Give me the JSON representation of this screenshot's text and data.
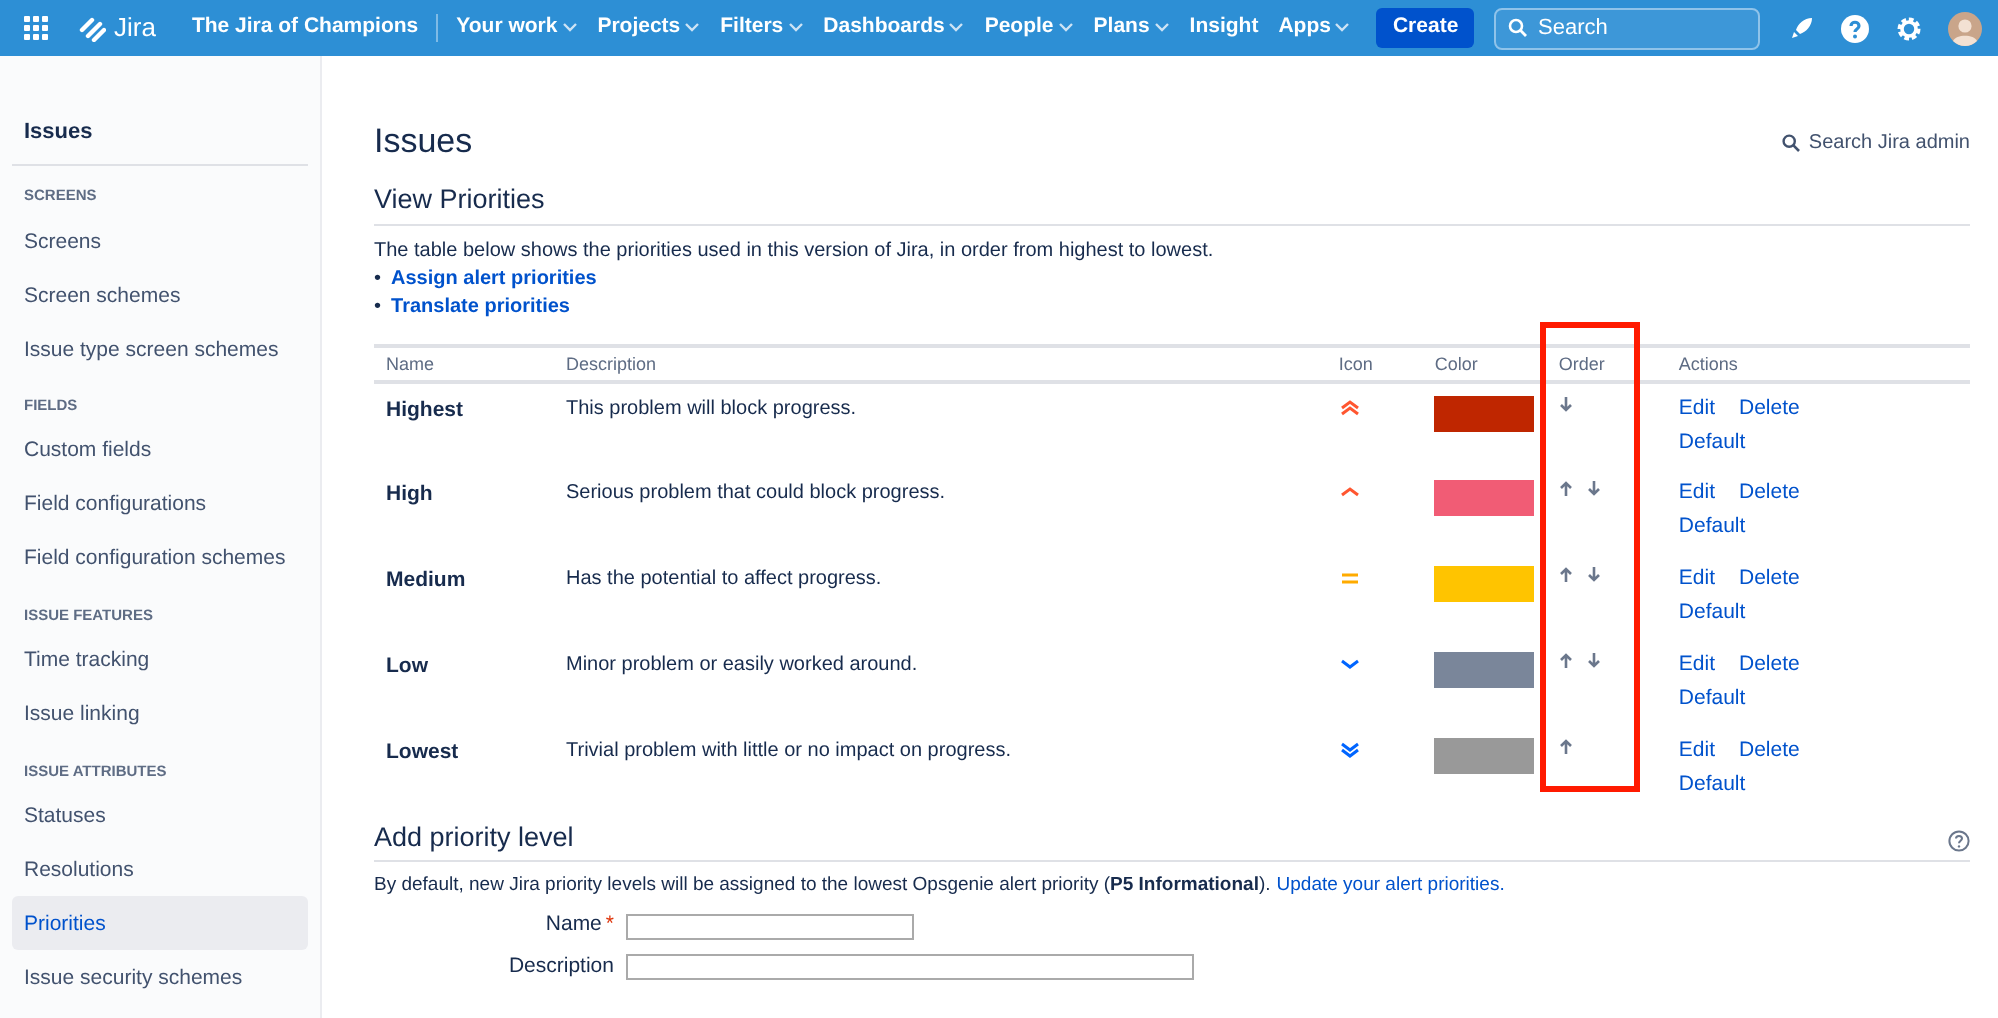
{
  "topbar": {
    "product": "Jira",
    "site": "The Jira of Champions",
    "nav": [
      {
        "label": "Your work",
        "dropdown": true
      },
      {
        "label": "Projects",
        "dropdown": true
      },
      {
        "label": "Filters",
        "dropdown": true
      },
      {
        "label": "Dashboards",
        "dropdown": true
      },
      {
        "label": "People",
        "dropdown": true
      },
      {
        "label": "Plans",
        "dropdown": true
      },
      {
        "label": "Insight",
        "dropdown": false
      },
      {
        "label": "Apps",
        "dropdown": true
      }
    ],
    "create": "Create",
    "search": {
      "placeholder": "Search"
    }
  },
  "sidebar": {
    "title": "Issues",
    "sections": [
      {
        "heading": "SCREENS",
        "items": [
          {
            "label": "Screens",
            "selected": false
          },
          {
            "label": "Screen schemes",
            "selected": false
          },
          {
            "label": "Issue type screen schemes",
            "selected": false
          }
        ]
      },
      {
        "heading": "FIELDS",
        "items": [
          {
            "label": "Custom fields",
            "selected": false
          },
          {
            "label": "Field configurations",
            "selected": false
          },
          {
            "label": "Field configuration schemes",
            "selected": false
          }
        ]
      },
      {
        "heading": "ISSUE FEATURES",
        "items": [
          {
            "label": "Time tracking",
            "selected": false
          },
          {
            "label": "Issue linking",
            "selected": false
          }
        ]
      },
      {
        "heading": "ISSUE ATTRIBUTES",
        "items": [
          {
            "label": "Statuses",
            "selected": false
          },
          {
            "label": "Resolutions",
            "selected": false
          },
          {
            "label": "Priorities",
            "selected": true
          },
          {
            "label": "Issue security schemes",
            "selected": false
          }
        ]
      }
    ]
  },
  "page": {
    "title": "Issues",
    "admin_search": "Search Jira admin",
    "view": {
      "title": "View Priorities",
      "intro": "The table below shows the priorities used in this version of Jira, in order from highest to lowest.",
      "links": [
        {
          "marker": "•",
          "label": "Assign alert priorities"
        },
        {
          "marker": "•",
          "label": "Translate priorities"
        }
      ],
      "table": {
        "columns": [
          {
            "label": "Name",
            "highlighted": false
          },
          {
            "label": "Description",
            "highlighted": false
          },
          {
            "label": "Icon",
            "highlighted": false
          },
          {
            "label": "Color",
            "highlighted": false
          },
          {
            "label": "Order",
            "highlighted": true
          },
          {
            "label": "Actions",
            "highlighted": false
          }
        ],
        "rows": [
          {
            "name": "Highest",
            "description": "This problem will block progress.",
            "kind": "highest",
            "color": "#bf2600",
            "up": false,
            "down": true,
            "actions": [
              "Edit",
              "Delete",
              "Default"
            ]
          },
          {
            "name": "High",
            "description": "Serious problem that could block progress.",
            "kind": "high",
            "color": "#f15c75",
            "up": true,
            "down": true,
            "actions": [
              "Edit",
              "Delete",
              "Default"
            ]
          },
          {
            "name": "Medium",
            "description": "Has the potential to affect progress.",
            "kind": "medium",
            "color": "#ffc400",
            "up": true,
            "down": true,
            "actions": [
              "Edit",
              "Delete",
              "Default"
            ]
          },
          {
            "name": "Low",
            "description": "Minor problem or easily worked around.",
            "kind": "low",
            "color": "#7a869a",
            "up": true,
            "down": true,
            "actions": [
              "Edit",
              "Delete",
              "Default"
            ]
          },
          {
            "name": "Lowest",
            "description": "Trivial problem with little or no impact on progress.",
            "kind": "lowest",
            "color": "#999999",
            "up": true,
            "down": false,
            "actions": [
              "Edit",
              "Delete",
              "Default"
            ]
          }
        ]
      }
    },
    "add": {
      "title": "Add priority level",
      "text": "By default, new Jira priority levels will be assigned to the lowest Opsgenie alert priority (**P5 Informational**).",
      "link": "Update your alert priorities.",
      "fields": [
        {
          "label": "Name",
          "required_mark": "*"
        },
        {
          "label": "Description"
        }
      ]
    }
  }
}
